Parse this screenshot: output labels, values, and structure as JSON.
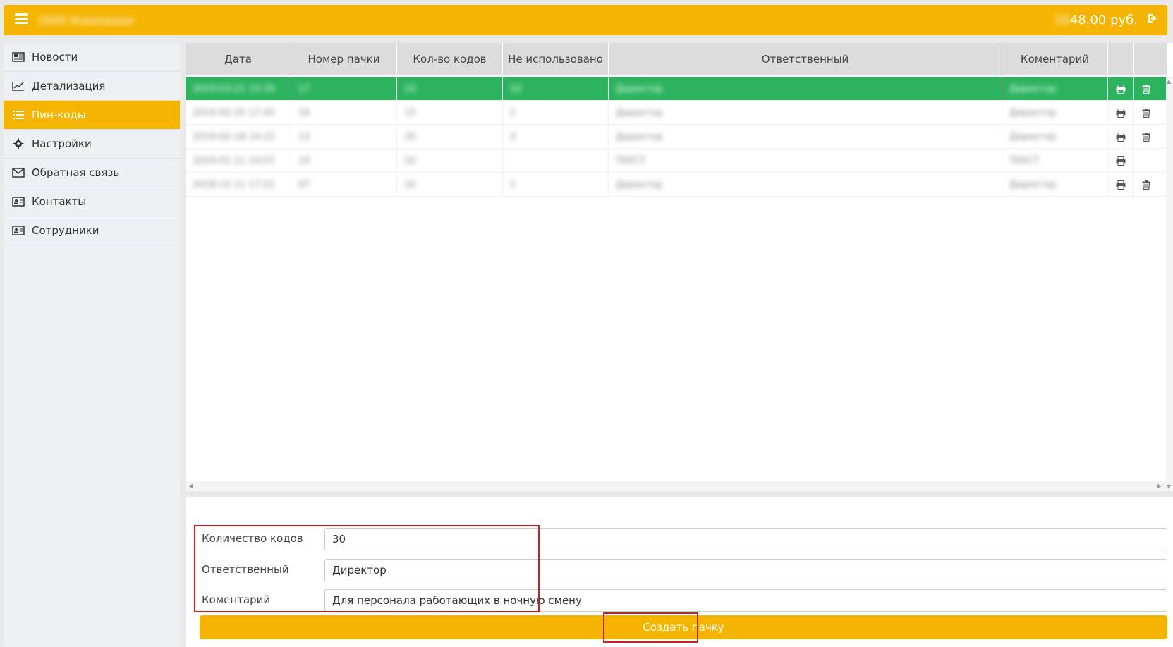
{
  "header": {
    "company_name": "ООО Компания",
    "balance_hidden": "10",
    "balance_visible": "48.00 руб."
  },
  "sidebar": {
    "items": [
      {
        "label": "Новости",
        "icon": "newspaper-icon"
      },
      {
        "label": "Детализация",
        "icon": "line-chart-icon"
      },
      {
        "label": "Пин-коды",
        "icon": "list-icon",
        "active": true
      },
      {
        "label": "Настройки",
        "icon": "gear-icon"
      },
      {
        "label": "Обратная связь",
        "icon": "envelope-icon"
      },
      {
        "label": "Контакты",
        "icon": "address-card-icon"
      },
      {
        "label": "Сотрудники",
        "icon": "address-card-icon"
      }
    ]
  },
  "table": {
    "headers": [
      "Дата",
      "Номер пачки",
      "Кол-во кодов",
      "Не использовано",
      "Ответственный",
      "Коментарий"
    ],
    "rows": [
      {
        "date": "2019-03-21 15:30",
        "num": "17",
        "count": "10",
        "unused": "10",
        "resp": "Директор",
        "comment": "Директор",
        "deletable": true
      },
      {
        "date": "2019-02-25 17:45",
        "num": "16",
        "count": "15",
        "unused": "2",
        "resp": "Директор",
        "comment": "Директор",
        "deletable": true
      },
      {
        "date": "2019-02-18 14:22",
        "num": "13",
        "count": "20",
        "unused": "4",
        "resp": "Директор",
        "comment": "Директор",
        "deletable": true
      },
      {
        "date": "2019-01-11 10:07",
        "num": "10",
        "count": "10",
        "unused": "",
        "resp": "ТЕКСТ",
        "comment": "ТЕКСТ",
        "deletable": false
      },
      {
        "date": "2018-12-11 17:51",
        "num": "07",
        "count": "10",
        "unused": "1",
        "resp": "Директор",
        "comment": "Директор",
        "deletable": true
      }
    ]
  },
  "form": {
    "count_label": "Количество кодов",
    "count_value": "30",
    "resp_label": "Ответственный",
    "resp_value": "Директор",
    "comment_label": "Коментарий",
    "comment_value": "Для персонала работающих в ночную смену",
    "create_button": "Создать пачку"
  },
  "colors": {
    "accent": "#f5b400",
    "selected_row": "#2db360",
    "highlight": "#cc1f1f"
  }
}
